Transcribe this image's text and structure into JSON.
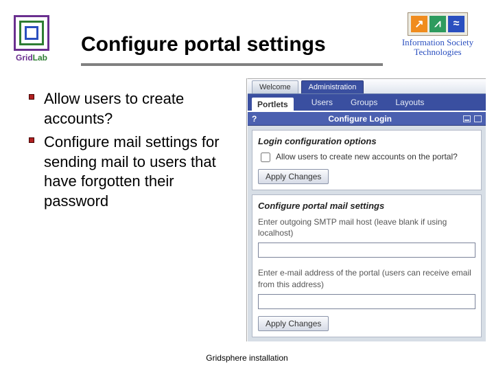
{
  "title": "Configure portal settings",
  "logo_left": {
    "label": "GridLab"
  },
  "logo_right": {
    "caption_line1": "Information Society",
    "caption_line2": "Technologies",
    "tile1": "↗",
    "tile2": "⩘",
    "tile3": "≈"
  },
  "bullets": [
    "Allow users to create accounts?",
    "Configure mail settings for sending mail to users that have forgotten their password"
  ],
  "tabs": {
    "inactive": "Welcome",
    "active": "Administration"
  },
  "subtabs": {
    "active": "Portlets",
    "items": [
      "Users",
      "Groups",
      "Layouts"
    ]
  },
  "bluebar": {
    "help": "?",
    "title": "Configure Login"
  },
  "login_section": {
    "header": "Login configuration options",
    "checkbox_label": "Allow users to create new accounts on the portal?",
    "apply": "Apply Changes"
  },
  "mail_section": {
    "header": "Configure portal mail settings",
    "smtp_label": "Enter outgoing SMTP mail host (leave blank if using localhost)",
    "smtp_value": "",
    "email_label": "Enter e-mail address of the portal (users can receive email from this address)",
    "email_value": "",
    "apply": "Apply Changes"
  },
  "footer": "Gridsphere installation"
}
